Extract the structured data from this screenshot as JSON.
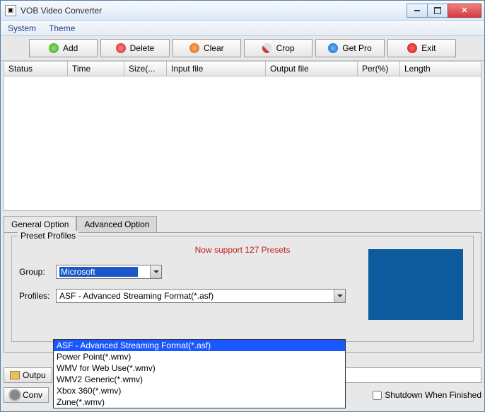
{
  "window": {
    "title": "VOB Video Converter"
  },
  "menu": {
    "system": "System",
    "theme": "Theme"
  },
  "toolbar": {
    "add": "Add",
    "delete": "Delete",
    "clear": "Clear",
    "crop": "Crop",
    "getpro": "Get Pro",
    "exit": "Exit"
  },
  "columns": {
    "status": "Status",
    "time": "Time",
    "size": "Size(...",
    "input": "Input file",
    "output": "Output file",
    "per": "Per(%)",
    "length": "Length"
  },
  "tabs": {
    "general": "General Option",
    "advanced": "Advanced Option"
  },
  "preset": {
    "legend": "Preset Profiles",
    "message": "Now support 127 Presets",
    "group_label": "Group:",
    "group_value": "Microsoft",
    "profiles_label": "Profiles:",
    "profiles_value": "ASF - Advanced Streaming Format(*.asf)"
  },
  "dropdown": {
    "items": [
      "ASF - Advanced Streaming Format(*.asf)",
      "Power Point(*.wmv)",
      "WMV for Web Use(*.wmv)",
      "WMV2 Generic(*.wmv)",
      "Xbox 360(*.wmv)",
      "Zune(*.wmv)"
    ],
    "selected_index": 0
  },
  "bottom": {
    "output_btn": "Outpu",
    "convert_btn": "Conv",
    "shutdown": "Shutdown When Finished"
  }
}
